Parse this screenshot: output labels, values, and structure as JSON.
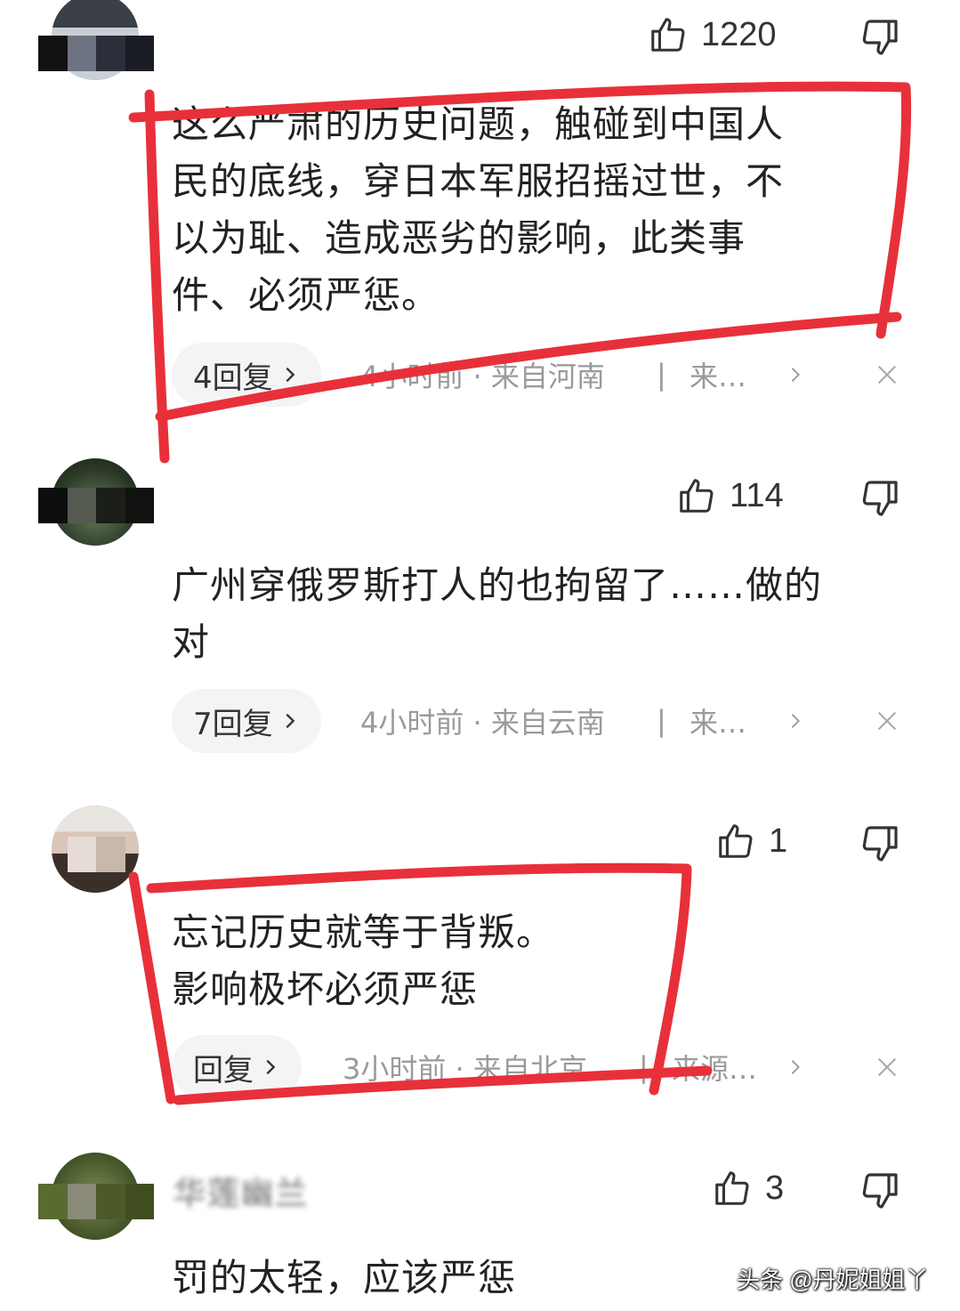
{
  "comments": [
    {
      "username": "",
      "likes": "1220",
      "lines": [
        "这么严肃的历史问题，触碰到中国人",
        "民的底线，穿日本军服招摇过世，不",
        "以为耻、造成恶劣的影响，此类事",
        "件、必须严惩。"
      ],
      "reply_label": "4回复",
      "time": "4小时前 · 来自河南",
      "source": "来…"
    },
    {
      "username": "",
      "likes": "114",
      "lines": [
        "广州穿俄罗斯打人的也拘留了……做的",
        "对"
      ],
      "reply_label": "7回复",
      "time": "4小时前 · 来自云南",
      "source": "来…"
    },
    {
      "username": "",
      "likes": "1",
      "lines": [
        "忘记历史就等于背叛。",
        "影响极坏必须严惩"
      ],
      "reply_label": "回复",
      "time": "3小时前 · 来自北京",
      "source": "来源…"
    },
    {
      "username": "华莲幽兰",
      "likes": "3",
      "lines": [
        "罚的太轻，应该严惩"
      ]
    }
  ],
  "separator": "|",
  "watermark": "头条 @丹妮姐姐丫",
  "colors": {
    "annotation_red": "#e8303a",
    "meta_gray": "#9a9a9a",
    "pill_bg": "#f4f4f4"
  },
  "icons": [
    "thumbs-up-icon",
    "thumbs-down-icon",
    "chevron-right-icon",
    "close-icon"
  ]
}
